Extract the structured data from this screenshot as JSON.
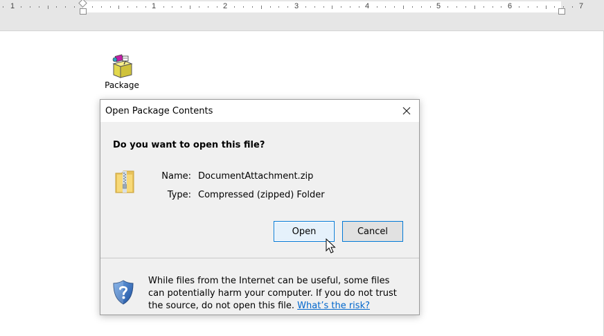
{
  "ruler": {
    "numbers": [
      "1",
      "1",
      "2",
      "3",
      "4",
      "5",
      "6",
      "7"
    ]
  },
  "package": {
    "label": "Package"
  },
  "dialog": {
    "title": "Open Package Contents",
    "question": "Do you want to open this file?",
    "name_label": "Name:",
    "name_value": "DocumentAttachment.zip",
    "type_label": "Type:",
    "type_value": "Compressed (zipped) Folder",
    "open_label": "Open",
    "cancel_label": "Cancel",
    "warning_text": "While files from the Internet can be useful, some files can potentially harm your computer. If you do not trust the source, do not open this file.",
    "risk_link": "What’s the risk?",
    "icons": {
      "close": "close-icon",
      "file": "zip-folder-icon",
      "shield": "shield-question-icon"
    }
  },
  "colors": {
    "accent": "#0078d7",
    "link": "#0066cc",
    "dialog_bg": "#f0f0f0"
  }
}
